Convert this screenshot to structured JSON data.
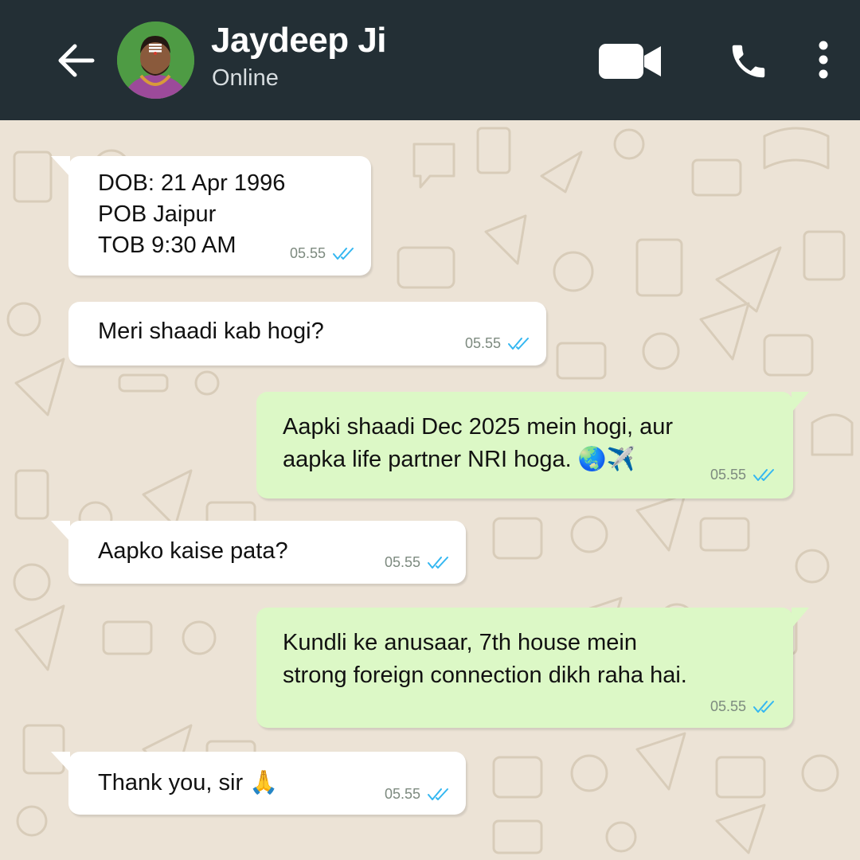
{
  "header": {
    "title": "Jaydeep Ji",
    "status": "Online",
    "icons": [
      "back-arrow-icon",
      "avatar",
      "video-call-icon",
      "phone-icon",
      "more-vertical-icon"
    ],
    "background": "#232f35"
  },
  "chat": {
    "background": "#ece3d6",
    "incoming_bubble_color": "#ffffff",
    "outgoing_bubble_color": "#dcf8c6",
    "tick_color": "#34b7f1",
    "messages": [
      {
        "direction": "incoming",
        "lines": [
          "DOB: 21 Apr 1996",
          "POB Jaipur",
          "TOB 9:30 AM"
        ],
        "time": "05.55"
      },
      {
        "direction": "incoming",
        "lines": [
          "Meri shaadi kab hogi?"
        ],
        "time": "05.55"
      },
      {
        "direction": "outgoing",
        "lines": [
          "Aapki shaadi Dec 2025 mein hogi, aur",
          "aapka life partner NRI hoga. 🌏✈️"
        ],
        "time": "05.55"
      },
      {
        "direction": "incoming",
        "lines": [
          "Aapko kaise pata?"
        ],
        "time": "05.55"
      },
      {
        "direction": "outgoing",
        "lines": [
          "Kundli ke anusaar, 7th house mein",
          "strong foreign connection dikh raha hai."
        ],
        "time": "05.55"
      },
      {
        "direction": "incoming",
        "lines": [
          "Thank you, sir 🙏"
        ],
        "time": "05.55"
      }
    ]
  }
}
